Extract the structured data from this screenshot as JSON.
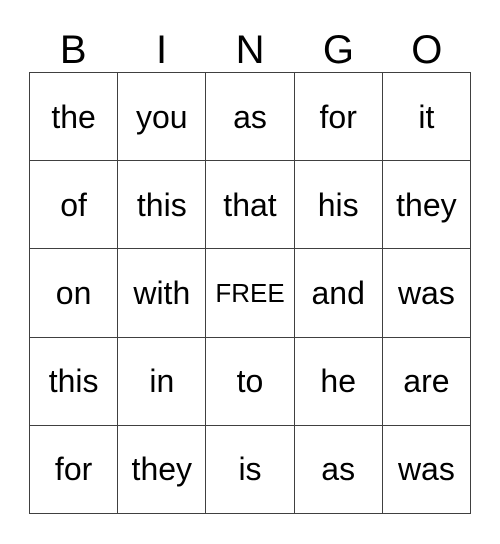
{
  "card": {
    "header_letters": [
      "B",
      "I",
      "N",
      "G",
      "O"
    ],
    "free_space_label": "FREE",
    "colors": {
      "background": "#ffffff",
      "border": "#404040",
      "text": "#000000"
    },
    "rows": [
      {
        "cells": [
          "the",
          "you",
          "as",
          "for",
          "it"
        ]
      },
      {
        "cells": [
          "of",
          "this",
          "that",
          "his",
          "they"
        ]
      },
      {
        "cells": [
          "on",
          "with",
          "FREE",
          "and",
          "was"
        ]
      },
      {
        "cells": [
          "this",
          "in",
          "to",
          "he",
          "are"
        ]
      },
      {
        "cells": [
          "for",
          "they",
          "is",
          "as",
          "was"
        ]
      }
    ]
  }
}
